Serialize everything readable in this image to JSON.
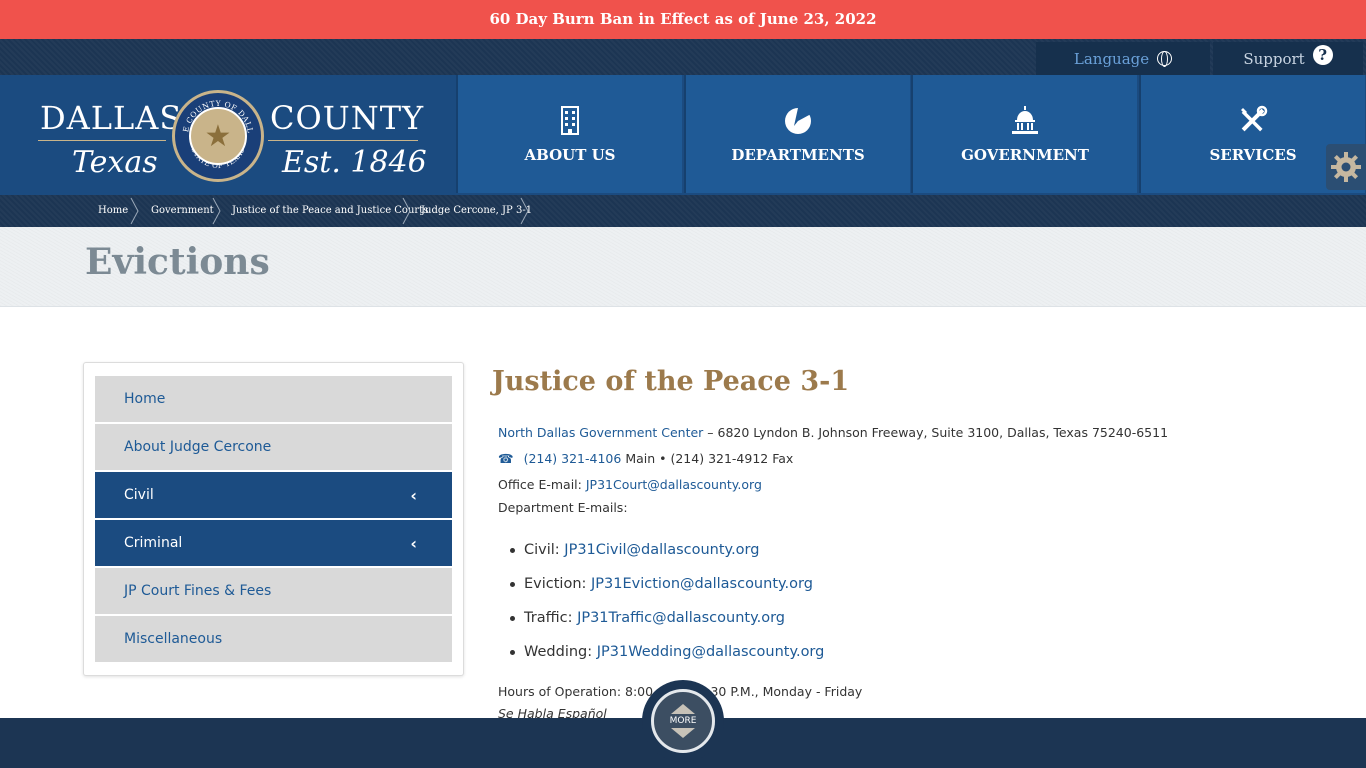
{
  "alert": {
    "text": "60 Day Burn Ban in Effect as of June 23, 2022"
  },
  "utility": {
    "language_label": "Language",
    "support_label": "Support"
  },
  "logo": {
    "line1_left": "DALLAS",
    "line1_right": "COUNTY",
    "line2_left": "Texas",
    "line2_right": "Est. 1846",
    "seal_text_top": "THE COUNTY OF DALLAS",
    "seal_text_bottom": "STATE OF TEXAS"
  },
  "nav": [
    {
      "label": "ABOUT US",
      "icon": "building-icon"
    },
    {
      "label": "DEPARTMENTS",
      "icon": "pie-chart-icon"
    },
    {
      "label": "GOVERNMENT",
      "icon": "capitol-icon"
    },
    {
      "label": "SERVICES",
      "icon": "tools-icon"
    }
  ],
  "breadcrumb": [
    "Home",
    "Government",
    "Justice of the Peace and Justice Courts",
    "Judge Cercone, JP 3-1"
  ],
  "page": {
    "title": "Evictions"
  },
  "sidebar": {
    "items": [
      {
        "label": "Home",
        "active": false
      },
      {
        "label": "About Judge Cercone",
        "active": false
      },
      {
        "label": "Civil",
        "active": true
      },
      {
        "label": "Criminal",
        "active": true
      },
      {
        "label": "JP Court Fines & Fees",
        "active": false
      },
      {
        "label": "Miscellaneous",
        "active": false
      }
    ]
  },
  "content": {
    "heading": "Justice of the Peace 3-1",
    "location_link": "North Dallas Government Center",
    "address": " – 6820 Lyndon B. Johnson Freeway, Suite 3100, Dallas, Texas 75240-6511",
    "phone_main": "(214) 321-4106",
    "phone_main_suffix": " Main • (214) 321-4912 Fax",
    "office_email_label": "Office E-mail: ",
    "office_email": "JP31Court@dallascounty.org",
    "dept_emails_label": "Department E-mails:",
    "dept_emails": [
      {
        "label": "Civil: ",
        "email": "JP31Civil@dallascounty.org"
      },
      {
        "label": "Eviction: ",
        "email": "JP31Eviction@dallascounty.org"
      },
      {
        "label": "Traffic: ",
        "email": "JP31Traffic@dallascounty.org"
      },
      {
        "label": "Wedding: ",
        "email": "JP31Wedding@dallascounty.org"
      }
    ],
    "hours": "Hours of Operation: 8:00 A.M. – 4:30 P.M., Monday - Friday",
    "spanish": "Se Habla Español"
  },
  "more_button": {
    "label": "MORE"
  }
}
